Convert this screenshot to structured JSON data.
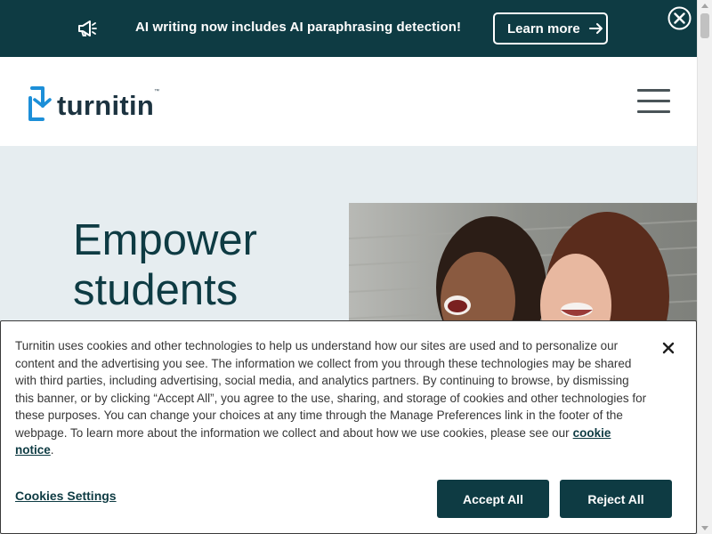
{
  "announcement": {
    "icon": "megaphone-icon",
    "message": "AI writing now includes AI paraphrasing detection!",
    "cta_label": "Learn more",
    "background": "#0e3b43"
  },
  "header": {
    "logo_text": "turnitin",
    "logo_tm": "™",
    "menu_icon": "hamburger-icon"
  },
  "hero": {
    "title_line1": "Empower",
    "title_line2": "students",
    "background": "#e6edf0"
  },
  "cookie_banner": {
    "body": "Turnitin uses cookies and other technologies to help us understand how our sites are used and to personalize our content and the advertising you see. The information we collect from you through these technologies may be shared with third parties, including advertising, social media, and analytics partners. By continuing to browse, by dismissing this banner, or by clicking “Accept All”, you agree to the use, sharing, and storage of cookies and other technologies for these purposes. You can change your choices at any time through the Manage Preferences link in the footer of the webpage. To learn more about the information we collect and about how we use cookies, please see our",
    "link_label": "cookie notice",
    "trailing": ".",
    "settings_label": "Cookies Settings",
    "accept_label": "Accept All",
    "reject_label": "Reject All",
    "button_color": "#0e3b43"
  }
}
